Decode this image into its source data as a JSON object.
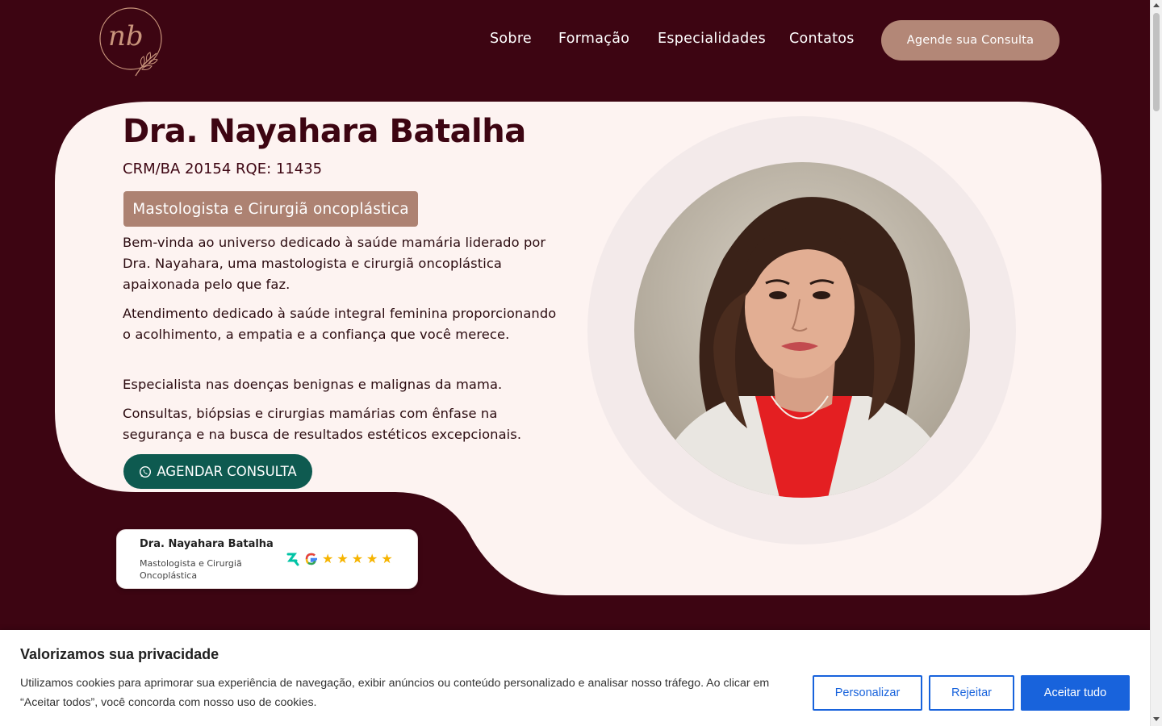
{
  "header": {
    "logo_text": "nb",
    "nav": [
      {
        "label": "Sobre"
      },
      {
        "label": "Formação"
      },
      {
        "label": "Especialidades"
      },
      {
        "label": "Contatos"
      }
    ],
    "cta_label": "Agende sua Consulta"
  },
  "hero": {
    "title": "Dra. Nayahara Batalha",
    "crm": "CRM/BA 20154 RQE: 11435",
    "badge": "Mastologista e Cirurgiã oncoplástica",
    "paragraphs": [
      "Bem-vinda ao universo dedicado à saúde mamária liderado por Dra. Nayahara, uma mastologista e cirurgiã oncoplástica apaixonada pelo que faz.",
      "Atendimento dedicado à saúde integral feminina proporcionando o acolhimento, a empatia e a confiança que você merece.",
      "Especialista nas doenças benignas e malignas da mama.",
      "Consultas, biópsias e cirurgias mamárias com ênfase na segurança e na busca de resultados estéticos excepcionais."
    ],
    "agendar_label": "AGENDAR CONSULTA",
    "agendar_icon": "whatsapp-icon"
  },
  "review_card": {
    "name": "Dra. Nayahara Batalha",
    "specialty": "Mastologista e Cirurgiã Oncoplástica",
    "rating": 5,
    "icons": [
      "doctoralia-icon",
      "google-icon"
    ]
  },
  "cookie_banner": {
    "title": "Valorizamos sua privacidade",
    "text": "Utilizamos cookies para aprimorar sua experiência de navegação, exibir anúncios ou conteúdo personalizado e analisar nosso tráfego. Ao clicar em “Aceitar todos”, você concorda com nosso uso de cookies.",
    "buttons": {
      "customize": "Personalizar",
      "reject": "Rejeitar",
      "accept": "Aceitar tudo"
    }
  },
  "colors": {
    "background": "#3d0512",
    "card": "#fdf3f1",
    "accent": "#b38777",
    "whatsapp_button": "#0e5a50",
    "cookie_primary": "#1863dc"
  }
}
